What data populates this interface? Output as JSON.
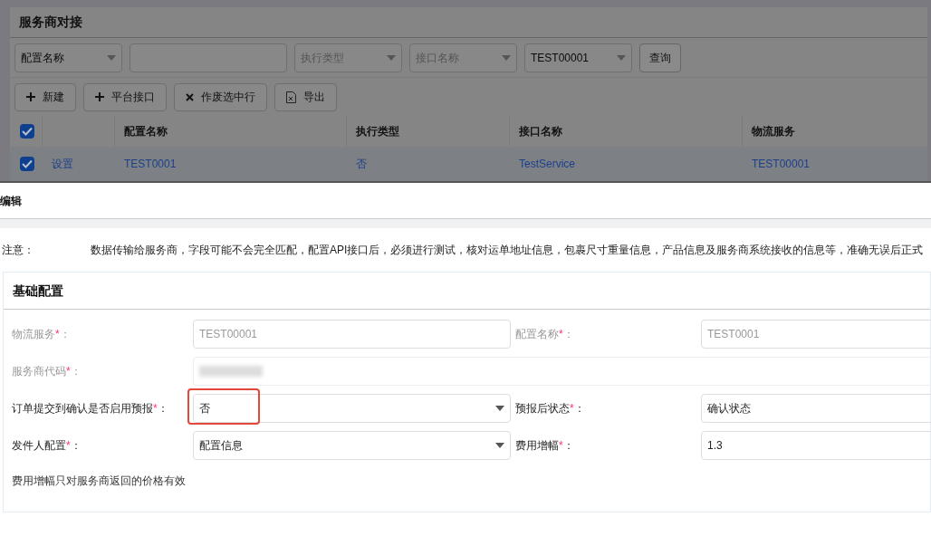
{
  "background": {
    "title": "服务商对接",
    "filters": [
      {
        "kind": "select",
        "value": "配置名称"
      },
      {
        "kind": "input"
      },
      {
        "kind": "select",
        "placeholder": "执行类型"
      },
      {
        "kind": "select",
        "placeholder": "接口名称"
      },
      {
        "kind": "select",
        "value": "TEST00001"
      }
    ],
    "search_button": "查询",
    "toolbar": [
      {
        "kind": "plus",
        "label": "新建"
      },
      {
        "kind": "plus",
        "label": "平台接口"
      },
      {
        "kind": "cross",
        "label": "作废选中行"
      },
      {
        "kind": "file",
        "label": "导出"
      }
    ],
    "table": {
      "all_checked": true,
      "columns": [
        "配置名称",
        "执行类型",
        "接口名称",
        "物流服务"
      ],
      "rows": [
        {
          "checked": true,
          "action": "设置",
          "cells": [
            "TEST0001",
            "否",
            "TestService",
            "TEST00001"
          ]
        }
      ]
    }
  },
  "dialog": {
    "title": "编辑",
    "note_label": "注意：",
    "note": "数据传输给服务商，字段可能不会完全匹配，配置API接口后，必须进行测试，核对运单地址信息，包裹尺寸重量信息，产品信息及服务商系统接收的信息等，准确无误后正式",
    "section": {
      "title": "基础配置",
      "rows": [
        [
          {
            "label": "物流服务",
            "mark": "*",
            "suffix": "：",
            "kind": "input",
            "disabled": true,
            "value": "TEST00001"
          },
          {
            "label": "配置名称",
            "mark": "*",
            "suffix": "：",
            "kind": "input",
            "disabled": true,
            "value": "TEST0001"
          }
        ],
        [
          {
            "label": "服务商代码",
            "mark": "*",
            "suffix": "：",
            "kind": "blurred",
            "disabled": true
          }
        ],
        [
          {
            "label": "订单提交到确认是否启用预报",
            "mark": "*",
            "suffix": "：",
            "kind": "select",
            "disabled": false,
            "value": "否",
            "highlighted": true
          },
          {
            "label": "预报后状态",
            "mark": "*",
            "suffix": "：",
            "kind": "input",
            "disabled": false,
            "value": "确认状态"
          }
        ],
        [
          {
            "label": "发件人配置",
            "mark": "*",
            "suffix": "：",
            "kind": "select",
            "disabled": false,
            "value": "配置信息"
          },
          {
            "label": "费用增幅",
            "mark": "*",
            "suffix": "：",
            "kind": "input",
            "disabled": false,
            "value": "1.3"
          }
        ]
      ],
      "hint": "费用增幅只对服务商返回的价格有效"
    }
  }
}
